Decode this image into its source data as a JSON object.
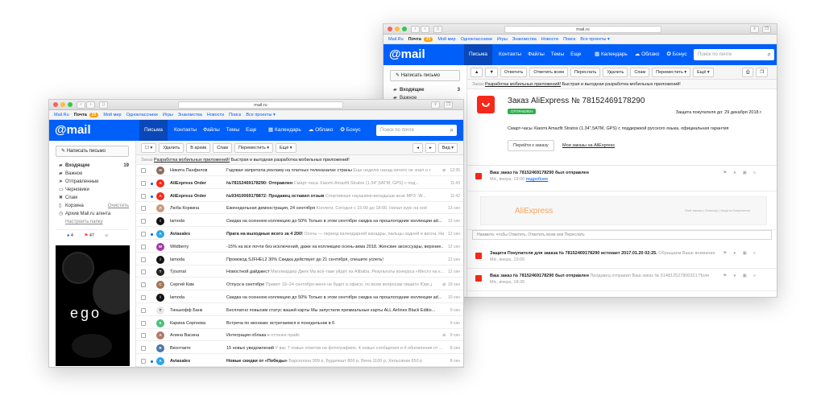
{
  "back": {
    "url": "mail.ru",
    "projects": [
      {
        "label": "Mail.Ru",
        "current": false
      },
      {
        "label": "Почта",
        "current": true,
        "badge": "23"
      },
      {
        "label": "Мой мир",
        "current": false
      },
      {
        "label": "Одноклассники",
        "current": false
      },
      {
        "label": "Игры",
        "current": false
      },
      {
        "label": "Знакомства",
        "current": false
      },
      {
        "label": "Новости",
        "current": false
      },
      {
        "label": "Поиск",
        "current": false
      },
      {
        "label": "Все проекты ▾",
        "current": false
      }
    ],
    "logo": "@mail",
    "nav": [
      "Письма",
      "Контакты",
      "Файлы",
      "Темы",
      "Еще"
    ],
    "apps": [
      "Календарь",
      "Облако",
      "Бонус"
    ],
    "search_placeholder": "Поиск по почте",
    "compose": "Написать письмо",
    "folders": [
      {
        "icon": "▰",
        "label": "Входящие",
        "count": "3",
        "bold": true
      },
      {
        "icon": "▰",
        "label": "Важное",
        "count": "",
        "bold": false
      }
    ],
    "toolbar": [
      "▲",
      "▼",
      "Ответить",
      "Ответить всем",
      "Переслать",
      "Удалить",
      "Спам",
      "Переместить ▾",
      "Ещё ▾"
    ],
    "promo": {
      "lead": "Заказ",
      "link": "Разработка мобильных приложений!",
      "text": "Быстрая и выгодная разработка мобильных приложений!"
    },
    "message": {
      "title": "Заказ AliExpress № 78152469178290",
      "tag": "ОТПРАВЛЕН",
      "buyer": "Защита покупателя до: 29 декабря 2018 г.",
      "item": "Смарт-часы Xiaomi Amazfit Stratos (1.34\",5ATM, GPS) с поддержкой русского языка, официальная гарантия",
      "goto": "Перейти к заказу",
      "myorders": "Мои заказы на AliExpress"
    },
    "thread": [
      {
        "title": "Ваш заказ № 78152469178290 был отправлен",
        "meta": "Мiс, вчера, 19:00",
        "link": "подробнее"
      },
      {
        "title": "Защита Покупателя для заказа № 78152469178290 истекает 2017.01.20 02:25.",
        "meta": "Мiс, вчера, 19:00",
        "extra": "Обращаем Ваше внимание"
      },
      {
        "title": "Ваш заказ № 78152469178290 был отправлен",
        "meta": "Мiс, вчера, 18:30",
        "extra": "Продавец отправил Ваш заказ № 514812527800321 Поле"
      }
    ],
    "banner_logo": "AliExpress",
    "banner_links": "Мой заказы | Помощь | Защита Покупателя",
    "reply_placeholder": "Нажмите, чтобы Ответить, Ответить всем или Переслать"
  },
  "front": {
    "url": "mail.ru",
    "projects": [
      {
        "label": "Mail.Ru",
        "current": false
      },
      {
        "label": "Почта",
        "current": true,
        "badge": "23"
      },
      {
        "label": "Мой мир",
        "current": false
      },
      {
        "label": "Одноклассники",
        "current": false
      },
      {
        "label": "Игры",
        "current": false
      },
      {
        "label": "Знакомства",
        "current": false
      },
      {
        "label": "Новости",
        "current": false
      },
      {
        "label": "Поиск",
        "current": false
      },
      {
        "label": "Все проекты ▾",
        "current": false
      }
    ],
    "logo": "@mail",
    "nav": [
      "Письма",
      "Контакты",
      "Файлы",
      "Темы",
      "Еще"
    ],
    "apps": [
      "Календарь",
      "Облако",
      "Бонус"
    ],
    "search_placeholder": "Поиск по почте",
    "compose": "Написать письмо",
    "folders": [
      {
        "icon": "▰",
        "label": "Входящие",
        "count": "19",
        "bold": true
      },
      {
        "icon": "▰",
        "label": "Важное",
        "count": "",
        "bold": false
      },
      {
        "icon": "➤",
        "label": "Отправленные",
        "count": "",
        "bold": false
      },
      {
        "icon": "▭",
        "label": "Черновики",
        "count": "",
        "bold": false
      },
      {
        "icon": "✖",
        "label": "Спам",
        "count": "",
        "bold": false
      },
      {
        "icon": "▯",
        "label": "Корзина",
        "count": "",
        "bold": false,
        "link": "Очистить"
      },
      {
        "icon": "◷",
        "label": "Архив Mail.ru агента",
        "count": "",
        "bold": false
      },
      {
        "icon": "",
        "label": "Настроить папку",
        "count": "",
        "bold": false
      }
    ],
    "quick": [
      "4",
      "47"
    ],
    "toolbar": [
      "Удалить",
      "В архив",
      "Спам",
      "Переместить ▾",
      "Ещё ▾"
    ],
    "view": "Вид ▾",
    "promo": {
      "lead": "Заказ",
      "link": "Разработка мобильных приложений!",
      "text": "Быстрая и выгодная разработка мобильных приложений!"
    },
    "ad_text": "ego",
    "emails": [
      {
        "sender": "Никита Панфилов",
        "subject": "Годовая запретила рекламу на платных телеканалах страны",
        "preview": "Еще неделю назад ничего не знал о т",
        "date": "12:35",
        "unread": false,
        "clip": true,
        "av": "#8b6b5a"
      },
      {
        "sender": "AliExpress Order",
        "subject": "№78152469178290: Отправлен",
        "preview": "Смарт-часы Xiaomi Amazfit Stratos (1.34\",5ATM, GPS) с под...",
        "date": "11:43",
        "unread": true,
        "clip": false,
        "av": "#f7291a"
      },
      {
        "sender": "AliExpress Order",
        "subject": "№93410069178872: Продавец оставил отзыв",
        "preview": "Спортивные наушники-вкладыши анзе MP3 ·W...",
        "date": "11:42",
        "unread": true,
        "clip": false,
        "av": "#f7291a"
      },
      {
        "sender": "Люба Коркина",
        "subject": "Еженедельная демонстрация, 24 сентября",
        "preview": "Коллеги, Сегодня с 15:00 до 18:00. Начал курс на ооё",
        "date": "13 сен",
        "unread": false,
        "clip": false,
        "av": "#c59a7e"
      },
      {
        "sender": "lamoda",
        "subject": "Скидка на осеннюю коллекцию до 50% Только в этом сентябре скидка на прошлогодние коллекции ad...",
        "preview": "",
        "date": "13 сен",
        "unread": false,
        "clip": false,
        "av": "#111111"
      },
      {
        "sender": "Aviasales",
        "subject": "Прага на выходные всего за 4 200!",
        "preview": "Осень — период календарной канадры, пальцы задней и весна. На ме...",
        "date": "12 сен",
        "unread": true,
        "clip": false,
        "av": "#2aa5e8"
      },
      {
        "sender": "Wildberry",
        "subject": "-15% на все  почти без исключений, даже на коллекцию осень-зима 2018. Женские аксессуары, верхние...",
        "preview": "",
        "date": "12 сен",
        "unread": false,
        "clip": false,
        "av": "#a23aa8"
      },
      {
        "sender": "lamoda",
        "subject": "Промокод SJFHEL2 30%  Скидка действует до 21 сентября, спешите успеть!",
        "preview": "",
        "date": "12 сен",
        "unread": false,
        "clip": false,
        "av": "#111111"
      },
      {
        "sender": "Tjournal",
        "subject": "Новостной дайджест",
        "preview": "Миллиардер Джек Ма всё-таки уйдёт из Alibaba, Результаты конкурса «Место на к...",
        "date": "12 сен",
        "unread": false,
        "clip": false,
        "av": "#222222"
      },
      {
        "sender": "Сергей Ким",
        "subject": "Отпуск в сентябре",
        "preview": "Привет 19–24 сентября меня не будет в офисе, по всем вопросам пишите Юре Д...",
        "date": "10 сен",
        "unread": false,
        "clip": true,
        "av": "#a47558"
      },
      {
        "sender": "lamoda",
        "subject": "Скидка на осеннюю коллекцию до 50% Только в этом сентябре скидка на прошлогодние коллекции ad...",
        "preview": "",
        "date": "10 сен",
        "unread": false,
        "clip": false,
        "av": "#111111"
      },
      {
        "sender": "Тинькофф Банк",
        "subject": "Бесплатно повысим статус вашей карты  Мы запустили премиальные карты ALL Airlines Black Editio...",
        "preview": "",
        "date": "9 сен",
        "unread": false,
        "clip": false,
        "av": "#e8e8e8"
      },
      {
        "sender": "Карина Сергеева",
        "subject": "Встреча по иконкам: встречаемся в понедельник в 6",
        "preview": "",
        "date": "9 сен",
        "unread": false,
        "clip": false,
        "av": "#4fbf7a"
      },
      {
        "sender": "Алина Васина",
        "subject": "Интеграция облака",
        "preview": "в оттенке прайс",
        "date": "9 сен",
        "unread": false,
        "clip": true,
        "av": "#b07a68"
      },
      {
        "sender": "Вконтакте",
        "subject": "15 новых уведомлений",
        "preview": "У вас 7 новых ответов на фотографиях, 4 новых сообщения и 4 обновления от ...",
        "date": "8 сен",
        "unread": false,
        "clip": false,
        "av": "#4a76a8"
      },
      {
        "sender": "Aviasales",
        "subject": "Новые скидки от «Победы»",
        "preview": "Барселона 999 р, Будапешт 800 р, Вена 1100 р, Хельсинки 650 р",
        "date": "8 сен",
        "unread": true,
        "clip": false,
        "av": "#2aa5e8"
      }
    ]
  },
  "colors": {
    "brand": "#005ff9",
    "ali": "#f7291a",
    "ok": "#2ab24a"
  }
}
